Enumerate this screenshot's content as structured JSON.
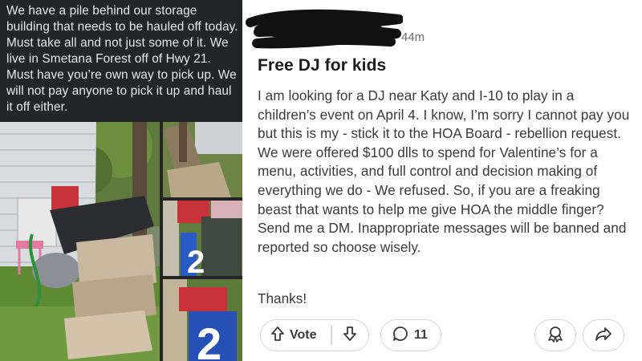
{
  "left_post": {
    "text": "We have a pile behind our storage building that needs to be hauled off today. Must take all and not just some of it. We live in Smetana Forest off of Hwy 21. Must have you’re own way to pick up. We will not pay anyone to pick it up and haul it off either.",
    "photos": [
      {
        "content": "junk pile of carpet, mattress and plastic crates beside a white building"
      },
      {
        "content": "wood planks and carpet on ground"
      },
      {
        "content": "trash bins with crates and blue panel"
      },
      {
        "content": "blue yard sign with white number"
      }
    ],
    "sign_number": "2"
  },
  "right_post": {
    "time": "44m",
    "title": "Free DJ for kids",
    "body": "I am looking for a DJ near Katy and I-10 to play in a children’s event on April 4. I know, I’m sorry I cannot pay you but this is my - stick it to the HOA Board - rebellion request. We were offered $100 dlls to spend for Valentine’s for a menu, activities, and full control and decision making of everything we do - We refused. So, if you are a freaking beast that wants to help me give HOA the middle finger? Send me a DM. Inappropriate messages will be banned and reported so choose wisely.",
    "thanks": "Thanks!",
    "actions": {
      "vote_label": "Vote",
      "comment_count": "11",
      "upvote_icon": "upvote-arrow-icon",
      "downvote_icon": "downvote-arrow-icon",
      "comment_icon": "comment-bubble-icon",
      "award_icon": "award-icon",
      "share_icon": "share-arrow-icon"
    }
  },
  "colors": {
    "left_bg": "#242526",
    "left_text": "#e8e8e8",
    "right_text": "#3a3a3a",
    "pill_border": "#d7d7d7",
    "redaction": "#111111"
  }
}
